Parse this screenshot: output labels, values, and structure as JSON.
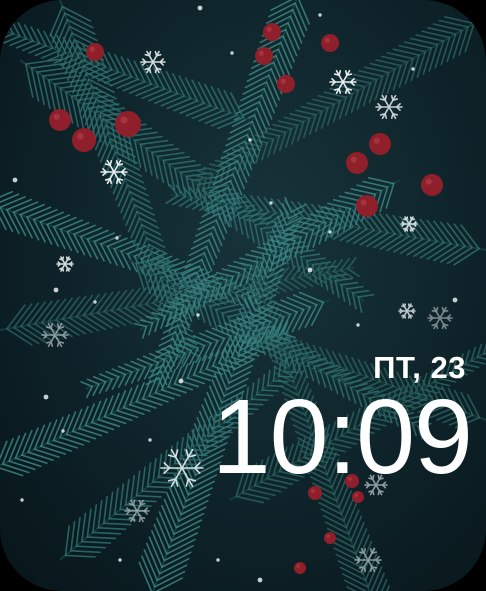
{
  "watch_face": {
    "date_label": "ПТ, 23",
    "time": "10:09",
    "theme": "winter-fir-branches",
    "colors": {
      "background": "#0f262c",
      "needles": "#3f8d8a",
      "berries": "#8f1f2a",
      "snowflakes": "#e8eef0",
      "text": "#ffffff"
    }
  }
}
